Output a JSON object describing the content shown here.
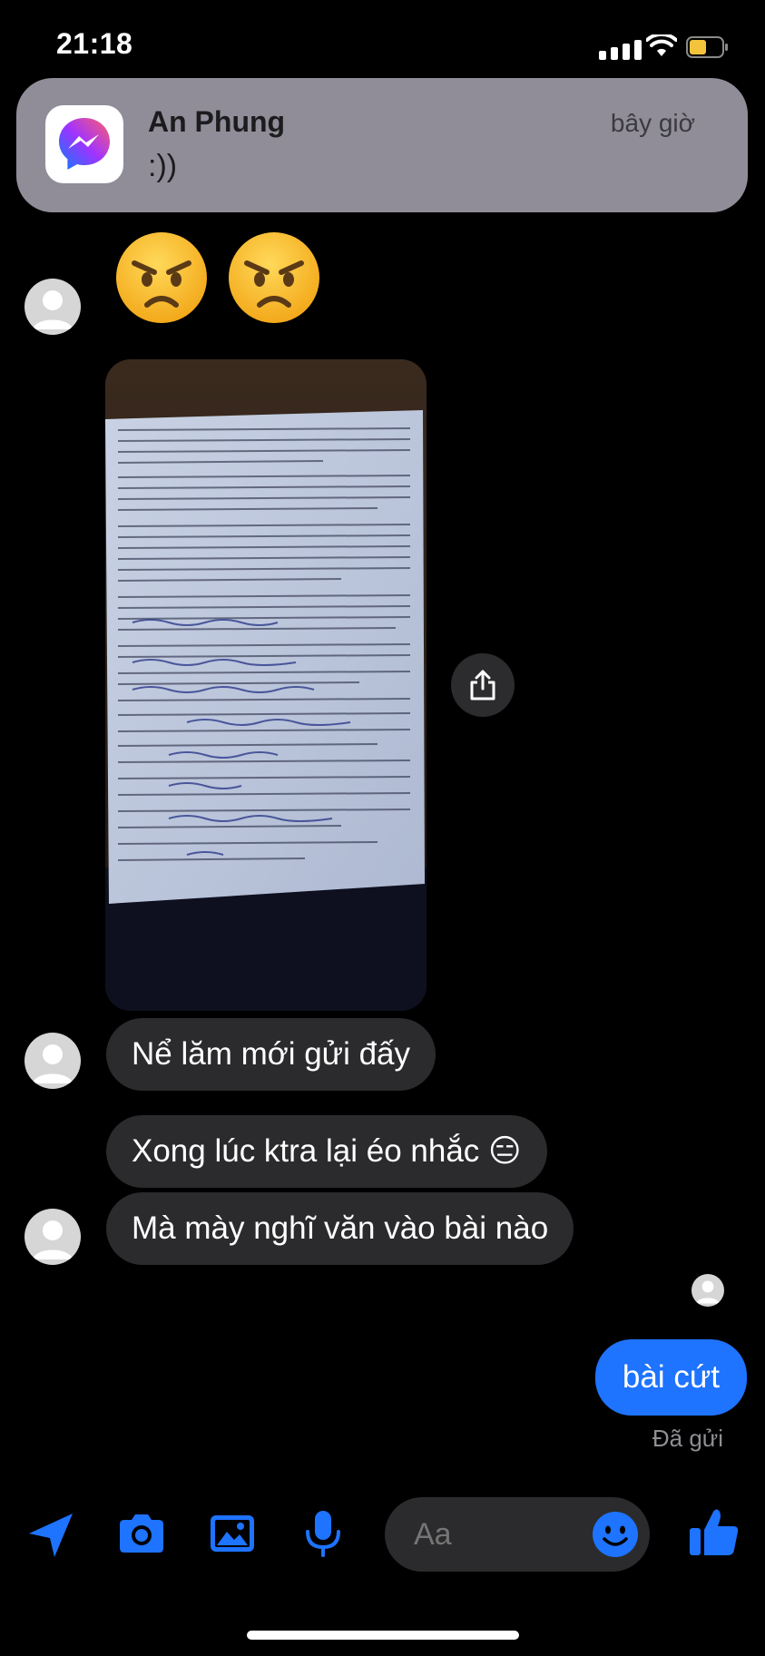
{
  "status_bar": {
    "time": "21:18",
    "battery_color": "#f3c33b"
  },
  "notification": {
    "app_icon": "messenger-icon",
    "sender": "An Phung",
    "message": ":))",
    "time": "bây giờ"
  },
  "conversation": {
    "emoji_message": [
      "😠",
      "😠"
    ],
    "photo": {
      "kind": "photo of a printed English worksheet with handwritten answers"
    },
    "incoming": [
      {
        "text": "Nể lăm mới gửi đấy"
      },
      {
        "text": "Xong lúc ktra lại éo nhắc 😑"
      },
      {
        "text": "Mà mày nghĩ văn vào bài nào"
      }
    ],
    "outgoing": [
      {
        "text": "bài cứt",
        "status": "Đã gửi"
      }
    ]
  },
  "composer": {
    "placeholder": "Aa",
    "tools": [
      "send-location-icon",
      "camera-icon",
      "gallery-icon",
      "microphone-icon"
    ],
    "emoji_button": "smiley-icon",
    "like_button": "thumbs-up-icon"
  },
  "colors": {
    "accent": "#1e73ff",
    "bubble_incoming": "#2b2b2d",
    "background": "#000000"
  }
}
